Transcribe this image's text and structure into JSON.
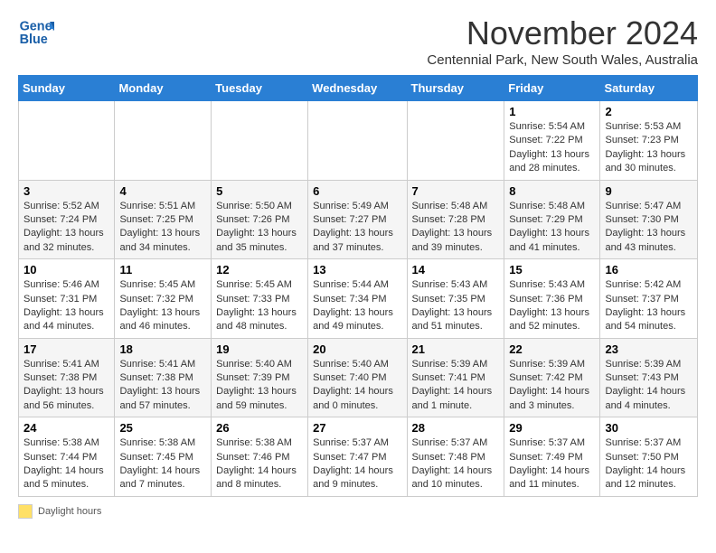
{
  "header": {
    "logo_line1": "General",
    "logo_line2": "Blue",
    "month_title": "November 2024",
    "subtitle": "Centennial Park, New South Wales, Australia"
  },
  "days_of_week": [
    "Sunday",
    "Monday",
    "Tuesday",
    "Wednesday",
    "Thursday",
    "Friday",
    "Saturday"
  ],
  "weeks": [
    [
      {
        "day": "",
        "info": ""
      },
      {
        "day": "",
        "info": ""
      },
      {
        "day": "",
        "info": ""
      },
      {
        "day": "",
        "info": ""
      },
      {
        "day": "",
        "info": ""
      },
      {
        "day": "1",
        "info": "Sunrise: 5:54 AM\nSunset: 7:22 PM\nDaylight: 13 hours and 28 minutes."
      },
      {
        "day": "2",
        "info": "Sunrise: 5:53 AM\nSunset: 7:23 PM\nDaylight: 13 hours and 30 minutes."
      }
    ],
    [
      {
        "day": "3",
        "info": "Sunrise: 5:52 AM\nSunset: 7:24 PM\nDaylight: 13 hours and 32 minutes."
      },
      {
        "day": "4",
        "info": "Sunrise: 5:51 AM\nSunset: 7:25 PM\nDaylight: 13 hours and 34 minutes."
      },
      {
        "day": "5",
        "info": "Sunrise: 5:50 AM\nSunset: 7:26 PM\nDaylight: 13 hours and 35 minutes."
      },
      {
        "day": "6",
        "info": "Sunrise: 5:49 AM\nSunset: 7:27 PM\nDaylight: 13 hours and 37 minutes."
      },
      {
        "day": "7",
        "info": "Sunrise: 5:48 AM\nSunset: 7:28 PM\nDaylight: 13 hours and 39 minutes."
      },
      {
        "day": "8",
        "info": "Sunrise: 5:48 AM\nSunset: 7:29 PM\nDaylight: 13 hours and 41 minutes."
      },
      {
        "day": "9",
        "info": "Sunrise: 5:47 AM\nSunset: 7:30 PM\nDaylight: 13 hours and 43 minutes."
      }
    ],
    [
      {
        "day": "10",
        "info": "Sunrise: 5:46 AM\nSunset: 7:31 PM\nDaylight: 13 hours and 44 minutes."
      },
      {
        "day": "11",
        "info": "Sunrise: 5:45 AM\nSunset: 7:32 PM\nDaylight: 13 hours and 46 minutes."
      },
      {
        "day": "12",
        "info": "Sunrise: 5:45 AM\nSunset: 7:33 PM\nDaylight: 13 hours and 48 minutes."
      },
      {
        "day": "13",
        "info": "Sunrise: 5:44 AM\nSunset: 7:34 PM\nDaylight: 13 hours and 49 minutes."
      },
      {
        "day": "14",
        "info": "Sunrise: 5:43 AM\nSunset: 7:35 PM\nDaylight: 13 hours and 51 minutes."
      },
      {
        "day": "15",
        "info": "Sunrise: 5:43 AM\nSunset: 7:36 PM\nDaylight: 13 hours and 52 minutes."
      },
      {
        "day": "16",
        "info": "Sunrise: 5:42 AM\nSunset: 7:37 PM\nDaylight: 13 hours and 54 minutes."
      }
    ],
    [
      {
        "day": "17",
        "info": "Sunrise: 5:41 AM\nSunset: 7:38 PM\nDaylight: 13 hours and 56 minutes."
      },
      {
        "day": "18",
        "info": "Sunrise: 5:41 AM\nSunset: 7:38 PM\nDaylight: 13 hours and 57 minutes."
      },
      {
        "day": "19",
        "info": "Sunrise: 5:40 AM\nSunset: 7:39 PM\nDaylight: 13 hours and 59 minutes."
      },
      {
        "day": "20",
        "info": "Sunrise: 5:40 AM\nSunset: 7:40 PM\nDaylight: 14 hours and 0 minutes."
      },
      {
        "day": "21",
        "info": "Sunrise: 5:39 AM\nSunset: 7:41 PM\nDaylight: 14 hours and 1 minute."
      },
      {
        "day": "22",
        "info": "Sunrise: 5:39 AM\nSunset: 7:42 PM\nDaylight: 14 hours and 3 minutes."
      },
      {
        "day": "23",
        "info": "Sunrise: 5:39 AM\nSunset: 7:43 PM\nDaylight: 14 hours and 4 minutes."
      }
    ],
    [
      {
        "day": "24",
        "info": "Sunrise: 5:38 AM\nSunset: 7:44 PM\nDaylight: 14 hours and 5 minutes."
      },
      {
        "day": "25",
        "info": "Sunrise: 5:38 AM\nSunset: 7:45 PM\nDaylight: 14 hours and 7 minutes."
      },
      {
        "day": "26",
        "info": "Sunrise: 5:38 AM\nSunset: 7:46 PM\nDaylight: 14 hours and 8 minutes."
      },
      {
        "day": "27",
        "info": "Sunrise: 5:37 AM\nSunset: 7:47 PM\nDaylight: 14 hours and 9 minutes."
      },
      {
        "day": "28",
        "info": "Sunrise: 5:37 AM\nSunset: 7:48 PM\nDaylight: 14 hours and 10 minutes."
      },
      {
        "day": "29",
        "info": "Sunrise: 5:37 AM\nSunset: 7:49 PM\nDaylight: 14 hours and 11 minutes."
      },
      {
        "day": "30",
        "info": "Sunrise: 5:37 AM\nSunset: 7:50 PM\nDaylight: 14 hours and 12 minutes."
      }
    ]
  ],
  "legend": {
    "daylight_label": "Daylight hours"
  }
}
